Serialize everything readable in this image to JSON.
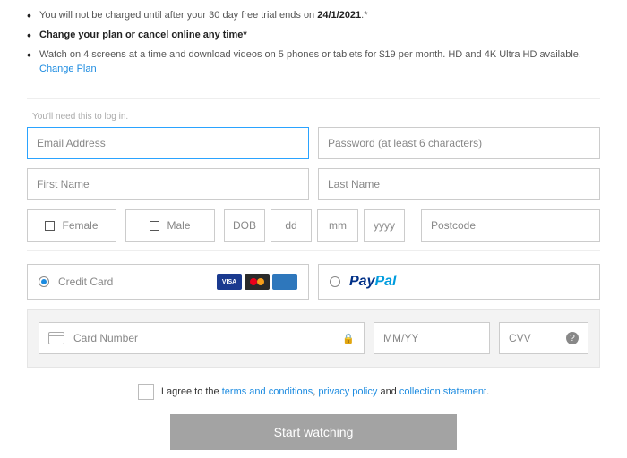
{
  "bullets": {
    "line1_pre": "You will not be charged until after your 30 day free trial ends on ",
    "line1_date": "24/1/2021",
    "line1_post": ".*",
    "line2": "Change your plan or cancel online any time*",
    "line3": "Watch on 4 screens at a time and download videos on 5 phones or tablets for $19 per month. HD and 4K Ultra HD available. ",
    "line3_link": "Change Plan"
  },
  "hint": "You'll need this to log in.",
  "fields": {
    "email": "Email Address",
    "password": "Password (at least 6 characters)",
    "first_name": "First Name",
    "last_name": "Last Name",
    "female": "Female",
    "male": "Male",
    "dob_label": "DOB",
    "dd": "dd",
    "mm": "mm",
    "yyyy": "yyyy",
    "postcode": "Postcode"
  },
  "payment": {
    "credit_card": "Credit Card",
    "visa": "VISA",
    "paypal_p1": "Pay",
    "paypal_p2": "Pal",
    "card_number": "Card Number",
    "mmyy": "MM/YY",
    "cvv": "CVV"
  },
  "agree": {
    "pre": "I agree to the ",
    "terms": "terms and conditions",
    "sep1": ", ",
    "privacy": "privacy policy",
    "sep2": " and ",
    "collection": "collection statement",
    "post": "."
  },
  "button": "Start watching"
}
